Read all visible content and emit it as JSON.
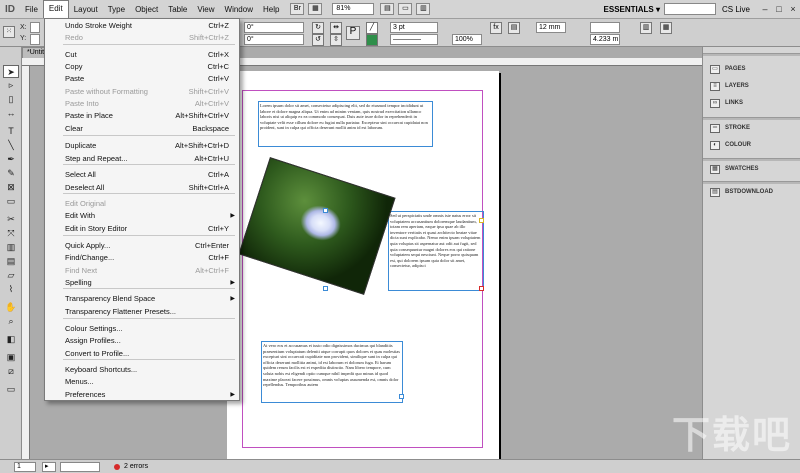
{
  "menubar": {
    "items": [
      "File",
      "Edit",
      "Layout",
      "Type",
      "Object",
      "Table",
      "View",
      "Window",
      "Help"
    ],
    "zoom": "81%",
    "workspace": "ESSENTIALS ▾",
    "cs_live": "CS Live"
  },
  "controlbar": {
    "x_label": "X:",
    "y_label": "Y:",
    "rot1": "0°",
    "rot2": "0°",
    "stroke_weight": "3 pt",
    "opacity": "100%",
    "dim1": "12 mm",
    "dim2": "4.233 m"
  },
  "doc_tab": "*Untit",
  "edit_menu": {
    "items": [
      {
        "label": "Undo Stroke Weight",
        "shortcut": "Ctrl+Z",
        "disabled": false
      },
      {
        "label": "Redo",
        "shortcut": "Shift+Ctrl+Z",
        "disabled": true
      },
      {
        "label": "Cut",
        "shortcut": "Ctrl+X",
        "disabled": false
      },
      {
        "label": "Copy",
        "shortcut": "Ctrl+C",
        "disabled": false
      },
      {
        "label": "Paste",
        "shortcut": "Ctrl+V",
        "disabled": false
      },
      {
        "label": "Paste without Formatting",
        "shortcut": "Shift+Ctrl+V",
        "disabled": true
      },
      {
        "label": "Paste Into",
        "shortcut": "Alt+Ctrl+V",
        "disabled": true
      },
      {
        "label": "Paste in Place",
        "shortcut": "Alt+Shift+Ctrl+V",
        "disabled": false
      },
      {
        "label": "Clear",
        "shortcut": "Backspace",
        "disabled": false
      },
      {
        "label": "Duplicate",
        "shortcut": "Alt+Shift+Ctrl+D",
        "disabled": false
      },
      {
        "label": "Step and Repeat...",
        "shortcut": "Alt+Ctrl+U",
        "disabled": false
      },
      {
        "label": "Select All",
        "shortcut": "Ctrl+A",
        "disabled": false
      },
      {
        "label": "Deselect All",
        "shortcut": "Shift+Ctrl+A",
        "disabled": false
      },
      {
        "label": "Edit Original",
        "shortcut": "",
        "disabled": true
      },
      {
        "label": "Edit With",
        "shortcut": "",
        "disabled": false,
        "submenu": true
      },
      {
        "label": "Edit in Story Editor",
        "shortcut": "Ctrl+Y",
        "disabled": false
      },
      {
        "label": "Quick Apply...",
        "shortcut": "Ctrl+Enter",
        "disabled": false
      },
      {
        "label": "Find/Change...",
        "shortcut": "Ctrl+F",
        "disabled": false
      },
      {
        "label": "Find Next",
        "shortcut": "Alt+Ctrl+F",
        "disabled": true
      },
      {
        "label": "Spelling",
        "shortcut": "",
        "disabled": false,
        "submenu": true
      },
      {
        "label": "Transparency Blend Space",
        "shortcut": "",
        "disabled": false,
        "submenu": true
      },
      {
        "label": "Transparency Flattener Presets...",
        "shortcut": "",
        "disabled": false
      },
      {
        "label": "Colour Settings...",
        "shortcut": "",
        "disabled": false
      },
      {
        "label": "Assign Profiles...",
        "shortcut": "",
        "disabled": false
      },
      {
        "label": "Convert to Profile...",
        "shortcut": "",
        "disabled": false
      },
      {
        "label": "Keyboard Shortcuts...",
        "shortcut": "",
        "disabled": false
      },
      {
        "label": "Menus...",
        "shortcut": "",
        "disabled": false
      },
      {
        "label": "Preferences",
        "shortcut": "",
        "disabled": false,
        "submenu": true
      }
    ]
  },
  "panels": {
    "group1": [
      "PAGES",
      "LAYERS",
      "LINKS"
    ],
    "group2": [
      "STROKE",
      "COLOUR"
    ],
    "group3": [
      "SWATCHES"
    ],
    "group4": [
      "BSTDOWNLOAD"
    ]
  },
  "document": {
    "text1": "Lorem ipsum dolor sit amet, consectetur adipiscing elit, sed do eiusmod tempor incididunt ut labore et dolore magna aliqua. Ut enim ad minim veniam, quis nostrud exercitation ullamco laboris nisi ut aliquip ex ea commodo consequat. Duis aute irure dolor in reprehenderit in voluptate velit esse cillum dolore eu fugiat nulla pariatur. Excepteur sint occaecat cupidatat non proident, sunt in culpa qui officia deserunt mollit anim id est laborum.",
    "text2": "Sed ut perspiciatis unde omnis iste natus error sit voluptatem accusantium doloremque laudantium, totam rem aperiam, eaque ipsa quae ab illo inventore veritatis et quasi architecto beatae vitae dicta sunt explicabo. Nemo enim ipsam voluptatem quia voluptas sit aspernatur aut odit aut fugit, sed quia consequuntur magni dolores eos qui ratione voluptatem sequi nesciunt. Neque porro quisquam est, qui dolorem ipsum quia dolor sit amet, consectetur, adipisci",
    "text3": "At vero eos et accusamus et iusto odio dignissimos ducimus qui blanditiis praesentium voluptatum deleniti atque corrupti quos dolores et quas molestias excepturi sint occaecati cupiditate non provident, similique sunt in culpa qui officia deserunt mollitia animi, id est laborum et dolorum fuga. Et harum quidem rerum facilis est et expedita distinctio. Nam libero tempore, cum soluta nobis est eligendi optio cumque nihil impedit quo minus id quod maxime placeat facere possimus, omnis voluptas assumenda est, omnis dolor repellendus. Temporibus autem"
  },
  "statusbar": {
    "page": "1",
    "errors": "2 errors"
  },
  "watermark": "下载吧"
}
